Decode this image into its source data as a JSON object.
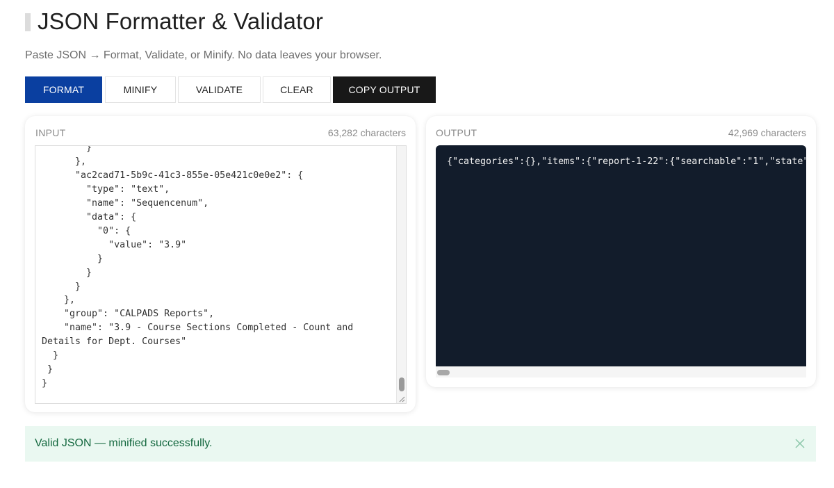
{
  "header": {
    "title": "JSON Formatter & Validator",
    "subtitle": "Paste JSON → Format, Validate, or Minify. No data leaves your browser."
  },
  "toolbar": {
    "format_label": "FORMAT",
    "minify_label": "MINIFY",
    "validate_label": "VALIDATE",
    "clear_label": "CLEAR",
    "copy_label": "COPY OUTPUT"
  },
  "input_panel": {
    "label": "INPUT",
    "count": "63,282 characters",
    "value": "        }\n      },\n      \"ac2cad71-5b9c-41c3-855e-05e421c0e0e2\": {\n        \"type\": \"text\",\n        \"name\": \"Sequencenum\",\n        \"data\": {\n          \"0\": {\n            \"value\": \"3.9\"\n          }\n        }\n      }\n    },\n    \"group\": \"CALPADS Reports\",\n    \"name\": \"3.9 - Course Sections Completed - Count and\nDetails for Dept. Courses\"\n  }\n }\n}"
  },
  "output_panel": {
    "label": "OUTPUT",
    "count": "42,969 characters",
    "value": "{\"categories\":{},\"items\":{\"report-1-22\":{\"searchable\":\"1\",\"state\""
  },
  "alert": {
    "message": "Valid JSON — minified successfully."
  },
  "colors": {
    "primary_button": "#0a3fa0",
    "copy_button": "#181818",
    "output_background": "#121c2b",
    "alert_background": "#eaf8f1",
    "alert_text": "#14683f"
  },
  "icons": {
    "close": "close-icon",
    "resize": "resize-handle-icon"
  }
}
